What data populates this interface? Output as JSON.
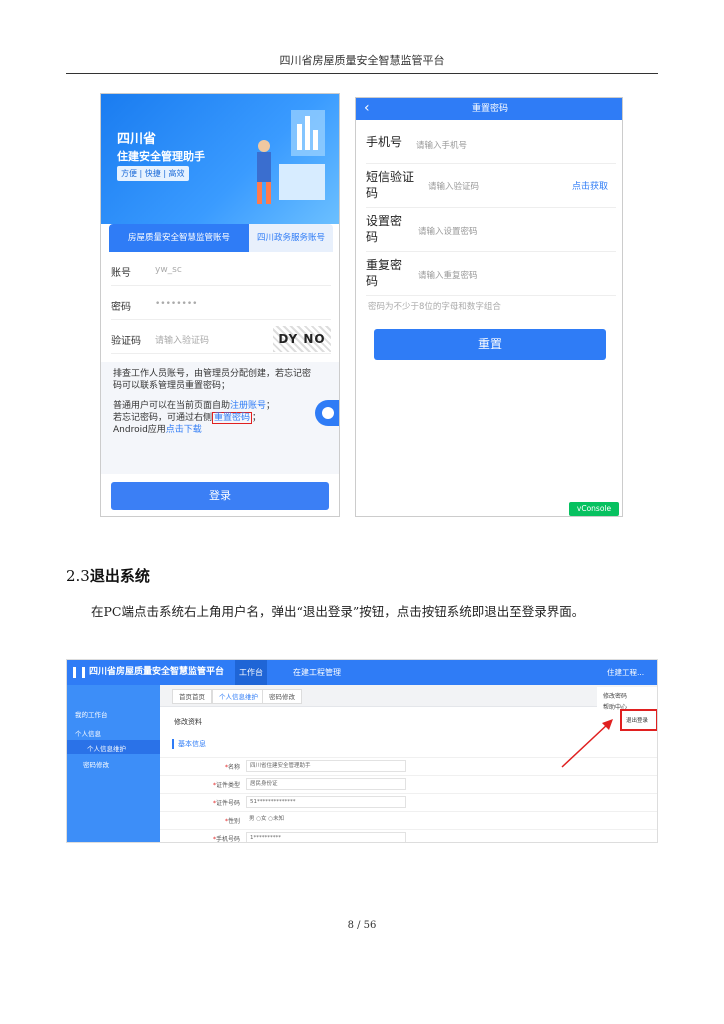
{
  "header": {
    "title": "四川省房屋质量安全智慧监管平台"
  },
  "phone_login": {
    "banner_title1": "四川省",
    "banner_title2": "住建安全管理助手",
    "banner_sub": "方便 | 快捷 | 高效",
    "tab_active": "房屋质量安全智慧监管账号",
    "tab_inactive": "四川政务服务账号",
    "account_label": "账号",
    "account_value": "yw_sc",
    "password_label": "密码",
    "password_value": "••••••••",
    "captcha_label": "验证码",
    "captcha_placeholder": "请输入验证码",
    "captcha_text": "DY NO",
    "info_line1": "排查工作人员账号，由管理员分配创建，若忘记密",
    "info_line2": "码可以联系管理员重置密码；",
    "info_line3_prefix": "普通用户可以在当前页面自助",
    "info_register_link": "注册账号",
    "info_line3_suffix": "；",
    "info_line4_prefix": "若忘记密码，可通过右侧",
    "info_reset_link": "重置密码",
    "info_line4_suffix": "；",
    "info_line5_prefix": "Android应用",
    "info_download_link": "点击下载",
    "login_button": "登录"
  },
  "phone_reset": {
    "bar_title": "重置密码",
    "back_icon": "‹",
    "phone_label": "手机号",
    "phone_placeholder": "请输入手机号",
    "sms_label_1": "短信验证",
    "sms_label_2": "码",
    "sms_placeholder": "请输入验证码",
    "sms_get": "点击获取",
    "setpwd_label_1": "设置密",
    "setpwd_label_2": "码",
    "setpwd_placeholder": "请输入设置密码",
    "repwd_label_1": "重复密",
    "repwd_label_2": "码",
    "repwd_placeholder": "请输入重复密码",
    "hint": "密码为不少于8位的字母和数字组合",
    "reset_button": "重置",
    "vconsole": "vConsole"
  },
  "section": {
    "number": "2.3",
    "title": "退出系统",
    "paragraph": "在PC端点击系统右上角用户名，弹出“退出登录”按钮，点击按钮系统即退出至登录界面。"
  },
  "pc": {
    "brand": "四川省房屋质量安全智慧监管平台",
    "nav_workbench": "工作台",
    "nav_project": "在建工程管理",
    "user": "住建工程...",
    "side_items": [
      "我的工作台",
      "个人信息",
      "个人信息维护",
      "密码修改"
    ],
    "tabs": [
      "首页首页",
      "个人信息维护",
      "密码修改"
    ],
    "heading": "修改资料",
    "base_info": "基本信息",
    "fields": [
      {
        "label": "名称",
        "value": "四川省住建安全管理助手"
      },
      {
        "label": "证件类型",
        "value": "居民身份证"
      },
      {
        "label": "证件号码",
        "value": "51**************"
      },
      {
        "label": "性别",
        "value": "男  ○女  ○未知"
      },
      {
        "label": "手机号码",
        "value": "1**********"
      }
    ],
    "menu": [
      "修改密码",
      "帮助中心",
      "退出登录"
    ]
  },
  "page_number": "8 / 56"
}
